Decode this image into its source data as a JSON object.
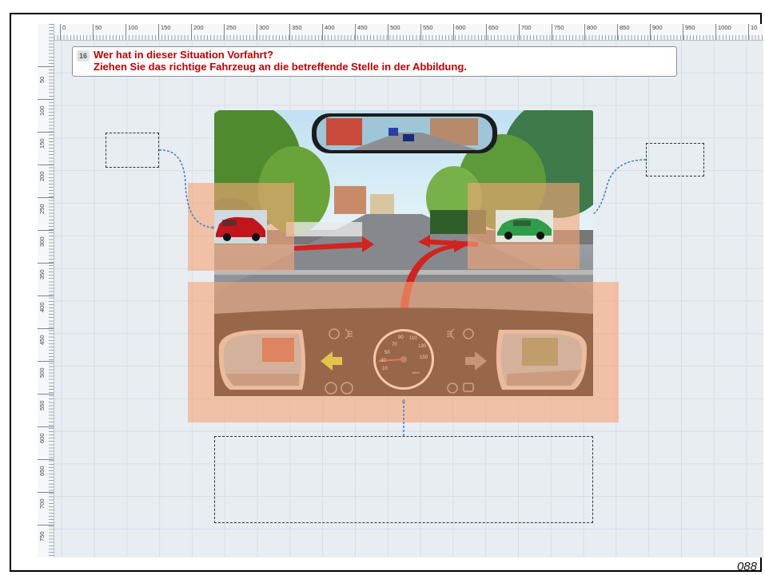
{
  "ruler": {
    "h_labels": [
      "0",
      "50",
      "100",
      "150",
      "200",
      "250",
      "300",
      "350",
      "400",
      "450",
      "500",
      "550",
      "600",
      "650",
      "700",
      "750",
      "800",
      "850",
      "900",
      "950",
      "1000",
      "10"
    ],
    "v_labels": [
      "50",
      "100",
      "150",
      "200",
      "250",
      "300",
      "350",
      "400",
      "450",
      "500",
      "550",
      "600",
      "650",
      "700",
      "750"
    ]
  },
  "question": {
    "number": "16",
    "title": "Wer hat in dieser Situation Vorfahrt?",
    "instruction": "Ziehen Sie das richtige Fahrzeug an die betreffende Stelle in der Abbildung."
  },
  "dashboard": {
    "speed_ticks": [
      "10",
      "20",
      "30",
      "50",
      "70",
      "90",
      "110",
      "130",
      "150"
    ],
    "unit": "km/h"
  },
  "page_number": "088",
  "colors": {
    "question_text": "#c00000",
    "hotspot": "#f6a678",
    "connector": "#3a7fd0",
    "arrow_red": "#d2231f",
    "indicator_left": "#c6f400"
  },
  "icons": [
    "airbag-off-icon",
    "headlight-icon",
    "left-arrow-indicator-icon",
    "right-arrow-indicator-icon",
    "abs-icon",
    "steering-icon",
    "seatbelt-icon",
    "traction-icon",
    "warning-icon"
  ]
}
